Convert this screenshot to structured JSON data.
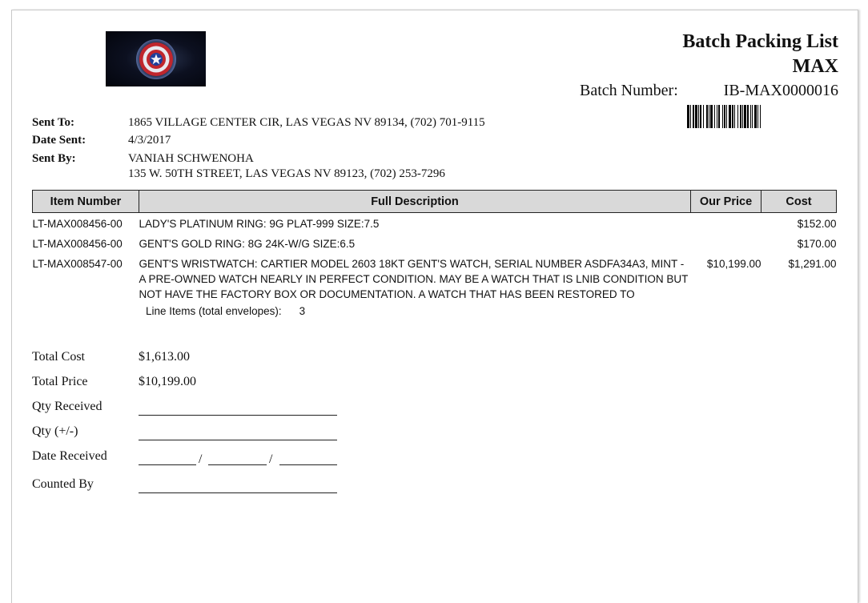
{
  "header": {
    "title": "Batch Packing List",
    "subtitle": "MAX",
    "batch_label": "Batch Number:",
    "batch_number": "IB-MAX0000016"
  },
  "logo": {
    "icon": "shield-star-icon"
  },
  "sent": {
    "to_label": "Sent To:",
    "to_value": "1865 VILLAGE CENTER CIR, LAS VEGAS NV 89134, (702) 701-9115",
    "date_label": "Date Sent:",
    "date_value": "4/3/2017",
    "by_label": "Sent By:",
    "by_name": "VANIAH SCHWENOHA",
    "by_address": "135 W. 50TH STREET, LAS VEGAS NV 89123, (702) 253-7296"
  },
  "table": {
    "headers": [
      "Item Number",
      "Full Description",
      "Our Price",
      "Cost"
    ],
    "rows": [
      {
        "item_number": "LT-MAX008456-00",
        "description": "LADY'S PLATINUM RING: 9G PLAT-999 SIZE:7.5",
        "our_price": "",
        "cost": "$152.00"
      },
      {
        "item_number": "LT-MAX008456-00",
        "description": "GENT'S GOLD RING: 8G 24K-W/G SIZE:6.5",
        "our_price": "",
        "cost": "$170.00"
      },
      {
        "item_number": "LT-MAX008547-00",
        "description": "GENT'S WRISTWATCH: CARTIER MODEL 2603 18KT GENT'S WATCH, SERIAL NUMBER ASDFA34A3, MINT - A PRE-OWNED WATCH NEARLY IN PERFECT CONDITION. MAY BE A WATCH THAT IS LNIB CONDITION BUT NOT HAVE THE FACTORY BOX OR DOCUMENTATION. A WATCH THAT HAS BEEN RESTORED TO",
        "our_price": "$10,199.00",
        "cost": "$1,291.00"
      }
    ],
    "line_items_label": "Line Items (total envelopes):",
    "line_items_count": "3"
  },
  "totals": {
    "total_cost_label": "Total Cost",
    "total_cost_value": "$1,613.00",
    "total_price_label": "Total Price",
    "total_price_value": "$10,199.00",
    "qty_received_label": "Qty Received",
    "qty_adjust_label": "Qty (+/-)",
    "date_received_label": "Date Received",
    "date_separator": "/",
    "counted_by_label": "Counted By"
  }
}
